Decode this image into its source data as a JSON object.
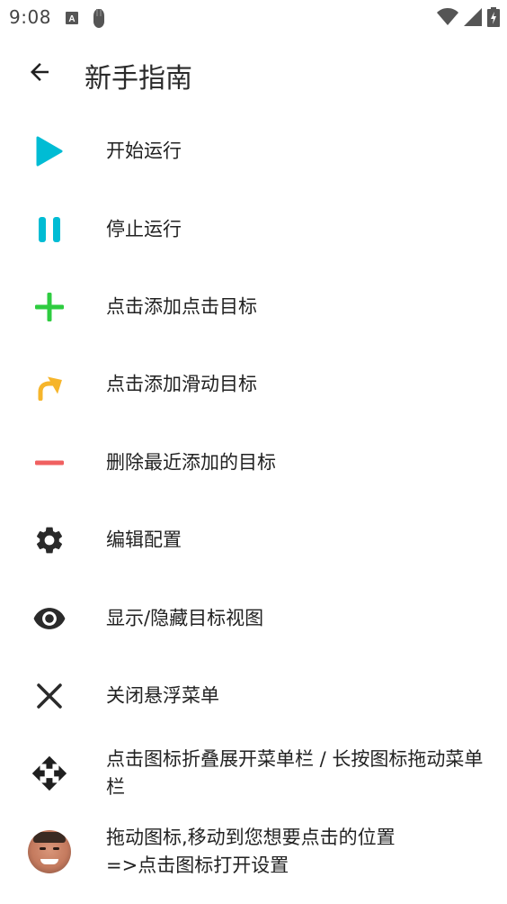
{
  "status_bar": {
    "time": "9:08",
    "icons_left": [
      "a-notification-icon",
      "hand-notification-icon"
    ],
    "icons_right": [
      "wifi-icon",
      "cell-signal-icon",
      "battery-charging-icon"
    ]
  },
  "app_bar": {
    "back_icon": "arrow-back-icon",
    "title": "新手指南"
  },
  "colors": {
    "play": "#00BCD4",
    "pause": "#00BCD4",
    "add": "#2ECC40",
    "swipe": "#F6B52B",
    "remove": "#F06060",
    "dark_icon": "#2a2a2a"
  },
  "guide": {
    "items": [
      {
        "icon": "play-icon",
        "label": "开始运行"
      },
      {
        "icon": "pause-icon",
        "label": "停止运行"
      },
      {
        "icon": "plus-icon",
        "label": "点击添加点击目标"
      },
      {
        "icon": "swipe-arrow-icon",
        "label": "点击添加滑动目标"
      },
      {
        "icon": "minus-icon",
        "label": "删除最近添加的目标"
      },
      {
        "icon": "gear-icon",
        "label": "编辑配置"
      },
      {
        "icon": "eye-icon",
        "label": "显示/隐藏目标视图"
      },
      {
        "icon": "close-icon",
        "label": "关闭悬浮菜单"
      },
      {
        "icon": "move-icon",
        "label": "点击图标折叠展开菜单栏 / 长按图标拖动菜单栏"
      },
      {
        "icon": "avatar-icon",
        "label": "拖动图标,移动到您想要点击的位置\n=>点击图标打开设置"
      }
    ]
  }
}
